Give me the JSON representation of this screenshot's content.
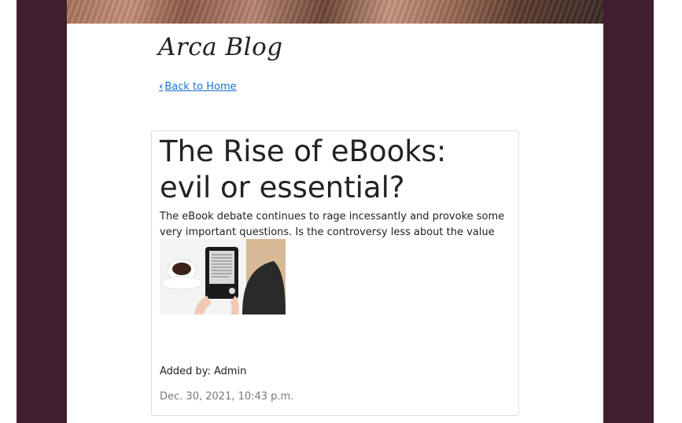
{
  "blog": {
    "title": "Arca Blog"
  },
  "nav": {
    "back_label": "Back to Home",
    "back_icon": "chevron-left-icon"
  },
  "post": {
    "title": "The Rise of eBooks: evil or essential?",
    "excerpt_line1": "The eBook debate continues to rage incessantly and provoke some",
    "excerpt_line2": "very important questions. Is the controversy less about the value o…",
    "author_label": "Added by:",
    "author": "Admin",
    "date": "Dec. 30, 2021, 10:43 p.m."
  },
  "colors": {
    "frame": "#3f1f2f",
    "link": "#1a73c8"
  }
}
